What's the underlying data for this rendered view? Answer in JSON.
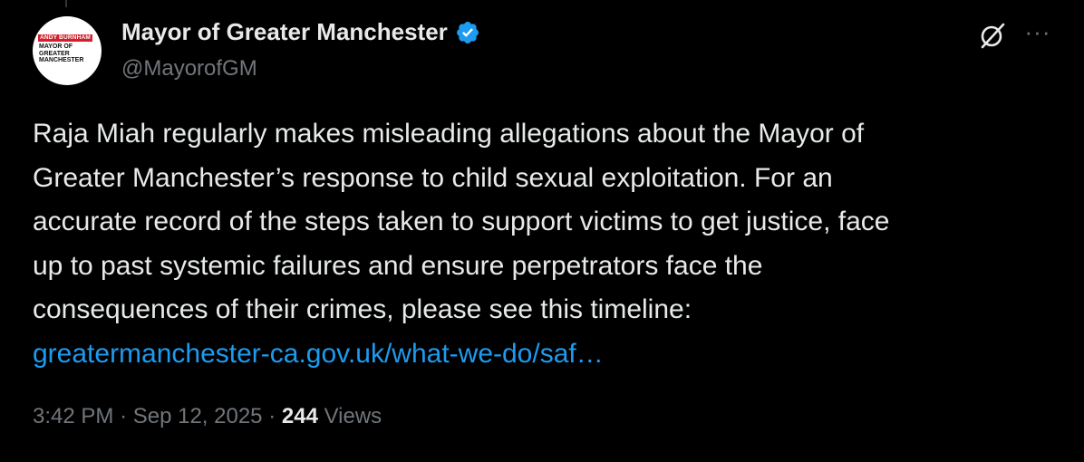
{
  "author": {
    "avatar": {
      "logo_top": "ANDY BURNHAM",
      "logo_lines": [
        "MAYOR OF",
        "GREATER",
        "MANCHESTER"
      ]
    },
    "display_name": "Mayor of Greater Manchester",
    "handle": "@MayorofGM",
    "verified": true
  },
  "icons": {
    "grok": "grok-icon",
    "more": "more-options-icon",
    "verified": "verified-badge-icon"
  },
  "colors": {
    "background": "#000000",
    "text": "#e7e9ea",
    "muted": "#71767b",
    "link": "#1d9bf0",
    "verified": "#1d9bf0"
  },
  "tweet": {
    "lines": [
      "Raja Miah regularly makes misleading allegations about the Mayor of",
      "Greater Manchester’s response to child sexual exploitation. For an",
      "accurate record of the steps taken to support victims to get justice, face",
      "up to past systemic failures and ensure perpetrators face the",
      "consequences of their crimes, please see this timeline:"
    ],
    "link_text": "greatermanchester-ca.gov.uk/what-we-do/saf…"
  },
  "meta": {
    "time": "3:42 PM",
    "separator": "·",
    "date": "Sep 12, 2025",
    "views_count": "244",
    "views_label": "Views"
  }
}
